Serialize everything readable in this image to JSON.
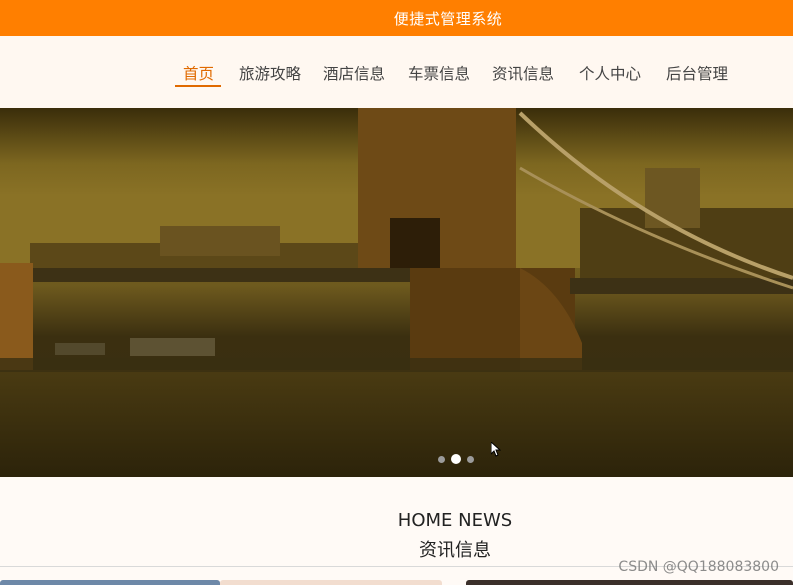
{
  "header": {
    "title": "便捷式管理系统"
  },
  "nav": {
    "items": [
      {
        "label": "首页",
        "active": true
      },
      {
        "label": "旅游攻略"
      },
      {
        "label": "酒店信息"
      },
      {
        "label": "车票信息"
      },
      {
        "label": "资讯信息"
      },
      {
        "label": "个人中心"
      },
      {
        "label": "后台管理"
      }
    ]
  },
  "carousel": {
    "slide_count": 3,
    "active_index": 1
  },
  "section": {
    "title_en": "HOME NEWS",
    "title_cn": "资讯信息"
  },
  "watermark": "CSDN @QQ188083800",
  "colors": {
    "accent": "#ff7f00",
    "active_nav": "#e06a00"
  }
}
